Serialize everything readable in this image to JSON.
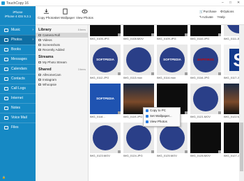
{
  "app": {
    "title": "TouchCopy 16",
    "window_controls": [
      "–",
      "□",
      "✕"
    ]
  },
  "device": {
    "name": "iPhone",
    "model": "iPhone 4 iOS 9.3.1"
  },
  "sidebar": {
    "items": [
      {
        "label": "Music",
        "icon": "music-icon",
        "chevron": "›"
      },
      {
        "label": "Photos",
        "icon": "photo-icon",
        "chevron": "›"
      },
      {
        "label": "Books",
        "icon": "book-icon",
        "chevron": ""
      },
      {
        "label": "Messages",
        "icon": "message-icon",
        "chevron": ""
      },
      {
        "label": "Calendars",
        "icon": "calendar-icon",
        "chevron": ""
      },
      {
        "label": "Contacts",
        "icon": "contacts-icon",
        "chevron": ""
      },
      {
        "label": "Call Logs",
        "icon": "phone-icon",
        "chevron": ""
      },
      {
        "label": "Internet",
        "icon": "globe-icon",
        "chevron": ""
      },
      {
        "label": "Notes",
        "icon": "notes-icon",
        "chevron": ""
      },
      {
        "label": "Voice Mail",
        "icon": "voicemail-icon",
        "chevron": ""
      },
      {
        "label": "Files",
        "icon": "folder-icon",
        "chevron": ""
      }
    ],
    "active_index": 1
  },
  "toolbar": {
    "copy_photos": "Copy Photos",
    "set_wallpaper": "Set Wallpaper",
    "view_photos": "View Photos",
    "purchase": "Purchase",
    "options": "Options",
    "activate": "Activate",
    "help": "Help"
  },
  "library": {
    "heading": "Library",
    "count": "8 items",
    "items": [
      "Camera Roll",
      "Videos",
      "Screenshots",
      "Recently Added"
    ]
  },
  "streams": {
    "heading": "Streams",
    "items": [
      "My Photo Stream"
    ]
  },
  "shared": {
    "heading": "Shared",
    "count": "3 items",
    "items": [
      "AllHomeCam",
      "Instagram",
      "Whoopsie"
    ]
  },
  "photos": [
    {
      "caption": "IMG_0105.JPG",
      "style": "dark"
    },
    {
      "caption": "IMG_0108.MOV",
      "style": "dark"
    },
    {
      "caption": "IMG_0109.JPG",
      "style": "dark"
    },
    {
      "caption": "IMG_0110.JPG",
      "style": "dark"
    },
    {
      "caption": "IMG_0111.JPG",
      "style": "circle",
      "text": ""
    },
    {
      "caption": "IMG_0112.JPG",
      "style": "circle",
      "text": "SOFTPEDIA"
    },
    {
      "caption": "IMG_0113.mov",
      "style": "circle",
      "text": ""
    },
    {
      "caption": "IMG_0114.mov",
      "style": "circle",
      "text": "SOFTPEDIA"
    },
    {
      "caption": "IMG_0116.JPG",
      "style": "circle-red",
      "text": "ΔΚΡΙΤΙΚΟΣ"
    },
    {
      "caption": "IMG_0117.JPG",
      "style": "blue-s",
      "text": "S"
    },
    {
      "caption": "IMG_0118...",
      "style": "banner",
      "text": "SOFTPEDIA"
    },
    {
      "caption": "IMG_0119.JPG",
      "style": "sunset"
    },
    {
      "caption": "IMG_0120.MOV",
      "style": "dark"
    },
    {
      "caption": "IMG_0121.MOV",
      "style": "circle",
      "text": ""
    },
    {
      "caption": "IMG_0122.MOV",
      "style": "sunset"
    },
    {
      "caption": "IMG_0123.MOV",
      "style": "circle",
      "text": ""
    },
    {
      "caption": "IMG_0124.JPG",
      "style": "circle",
      "text": ""
    },
    {
      "caption": "IMG_0125.MOV",
      "style": "circle",
      "text": ""
    },
    {
      "caption": "IMG_0126.MOV",
      "style": "dark"
    },
    {
      "caption": "IMG_0127.JPG",
      "style": "dark"
    }
  ],
  "context_menu": {
    "items": [
      {
        "label": "Copy to PC",
        "icon": "copy-icon"
      },
      {
        "label": "Set Wallpaper...",
        "icon": "wallpaper-icon"
      },
      {
        "label": "View Photos",
        "icon": "view-icon"
      }
    ]
  }
}
